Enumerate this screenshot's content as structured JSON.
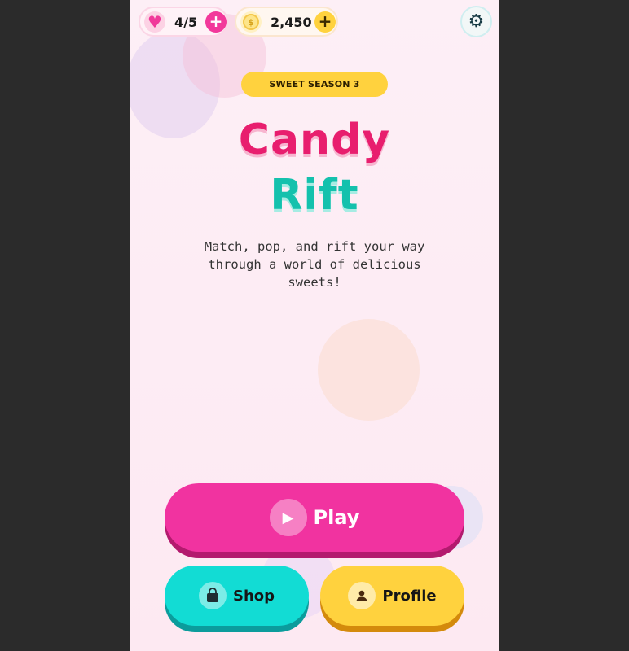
{
  "hud": {
    "lives": {
      "value": "4/5",
      "icon": "heart-icon",
      "add_icon": "plus-icon"
    },
    "coins": {
      "value": "2,450",
      "icon": "coin-icon",
      "coin_symbol": "$",
      "add_icon": "plus-icon"
    },
    "settings_icon": "gear-icon"
  },
  "header": {
    "season_badge": "SWEET SEASON 3",
    "title_line1": "Candy",
    "title_line2": "Rift",
    "tagline": "Match, pop, and rift your way through a world of delicious sweets!"
  },
  "actions": {
    "play": {
      "label": "Play",
      "icon": "play-icon"
    },
    "shop": {
      "label": "Shop",
      "icon": "shopping-bag-icon"
    },
    "profile": {
      "label": "Profile",
      "icon": "user-icon"
    }
  },
  "colors": {
    "primary_pink": "#f133a0",
    "title_pink": "#e81e6e",
    "title_teal": "#14c1ad",
    "shop_teal": "#12dcd4",
    "accent_yellow": "#ffd23e",
    "background": "#fdeff6"
  }
}
